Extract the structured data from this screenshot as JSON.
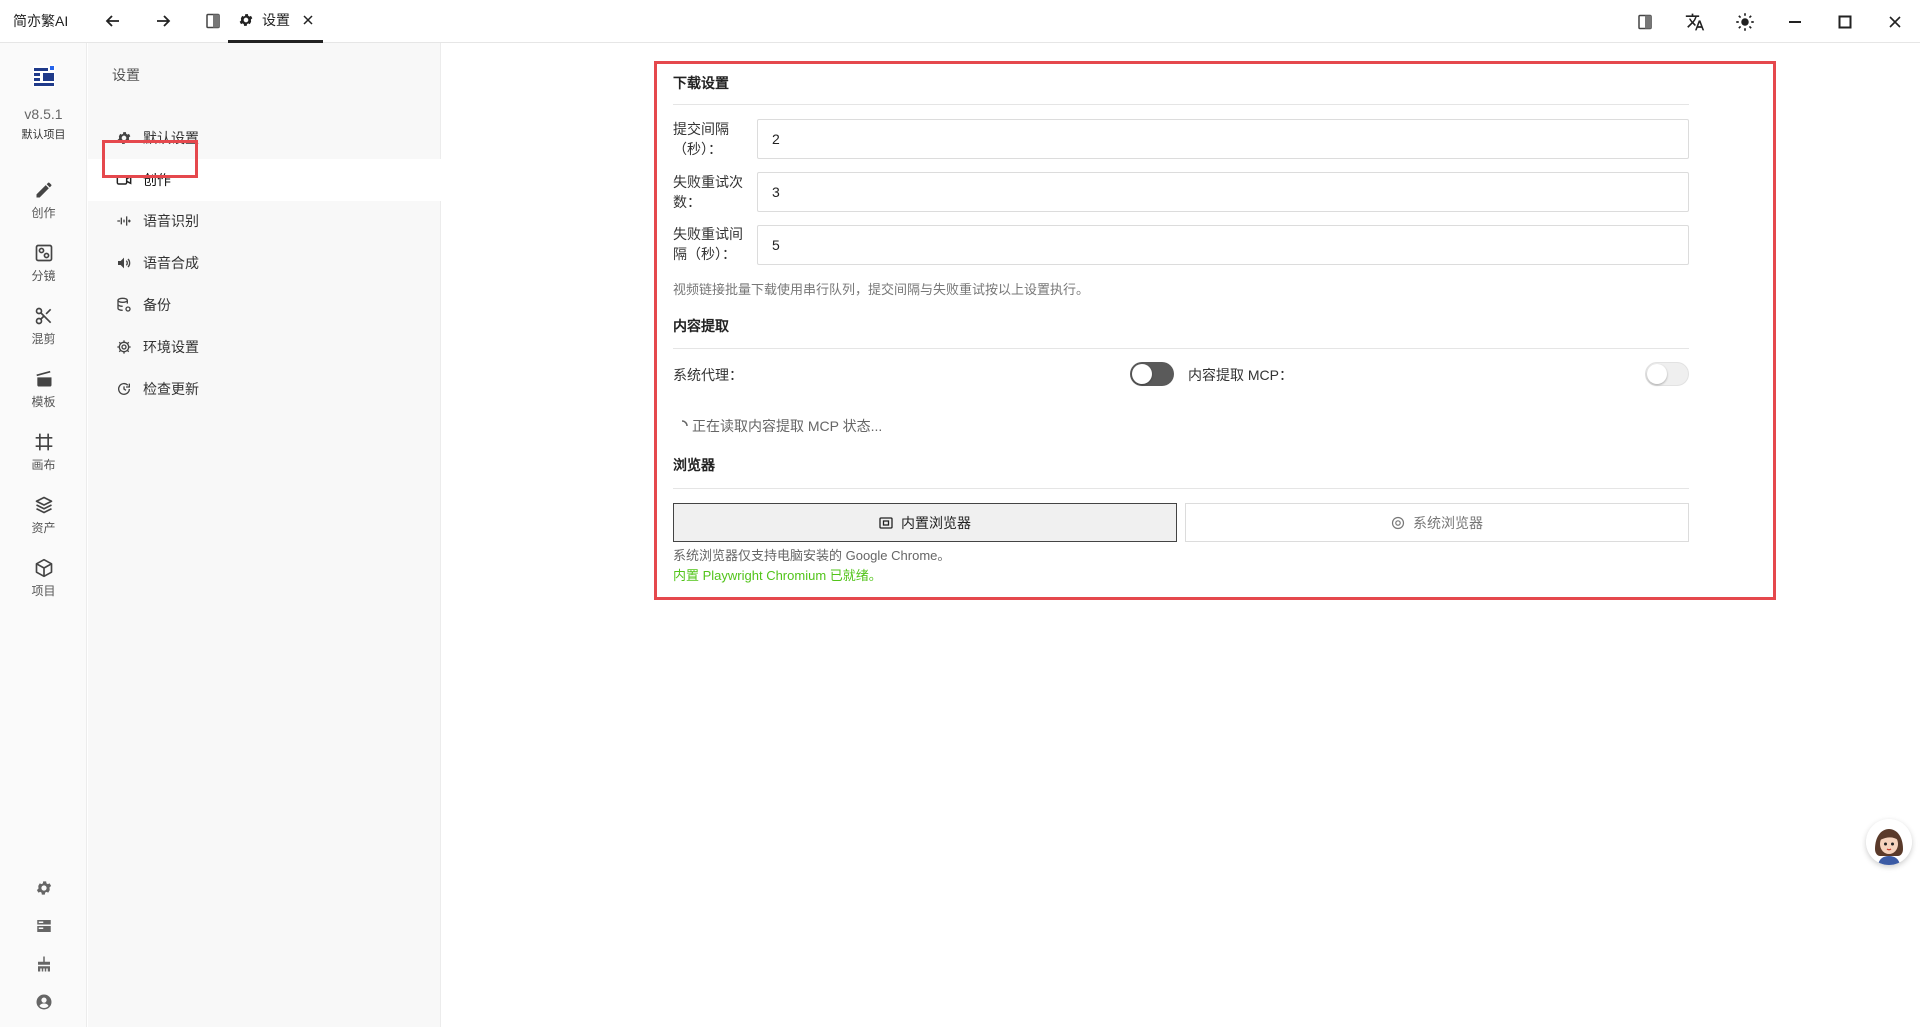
{
  "titlebar": {
    "app_name": "简亦繁AI",
    "tab_label": "设置"
  },
  "rail": {
    "version": "v8.5.1",
    "project": "默认项目",
    "items": [
      {
        "label": "创作",
        "icon": "pencil-icon"
      },
      {
        "label": "分镜",
        "icon": "storyboard-icon"
      },
      {
        "label": "混剪",
        "icon": "scissors-icon"
      },
      {
        "label": "模板",
        "icon": "clapperboard-icon"
      },
      {
        "label": "画布",
        "icon": "canvas-frame-icon"
      },
      {
        "label": "资产",
        "icon": "layers-icon"
      },
      {
        "label": "项目",
        "icon": "cube-icon"
      }
    ]
  },
  "nav": {
    "title": "设置",
    "items": [
      {
        "label": "默认设置",
        "icon": "gear-icon"
      },
      {
        "label": "创作",
        "icon": "video-camera-icon"
      },
      {
        "label": "语音识别",
        "icon": "waveform-icon"
      },
      {
        "label": "语音合成",
        "icon": "speaker-icon"
      },
      {
        "label": "备份",
        "icon": "database-icon"
      },
      {
        "label": "环境设置",
        "icon": "settings-cog-icon"
      },
      {
        "label": "检查更新",
        "icon": "refresh-icon"
      }
    ]
  },
  "download": {
    "title": "下载设置",
    "submit_interval_label_1": "提交间隔",
    "submit_interval_label_2": "（秒）：",
    "submit_interval_value": "2",
    "retry_count_label_1": "失败重试次",
    "retry_count_label_2": "数：",
    "retry_count_value": "3",
    "retry_interval_label_1": "失败重试间",
    "retry_interval_label_2": "隔（秒）：",
    "retry_interval_value": "5",
    "help": "视频链接批量下载使用串行队列，提交间隔与失败重试按以上设置执行。"
  },
  "content": {
    "title": "内容提取",
    "proxy_label": "系统代理：",
    "mcp_label": "内容提取 MCP：",
    "loading": "正在读取内容提取 MCP 状态..."
  },
  "browser": {
    "title": "浏览器",
    "builtin_label": "内置浏览器",
    "system_label": "系统浏览器",
    "note1": "系统浏览器仅支持电脑安装的 Google Chrome。",
    "note2": "内置 Playwright Chromium 已就绪。",
    "ready_color": "#52c41a"
  },
  "colors": {
    "highlight": "#e5484d"
  }
}
